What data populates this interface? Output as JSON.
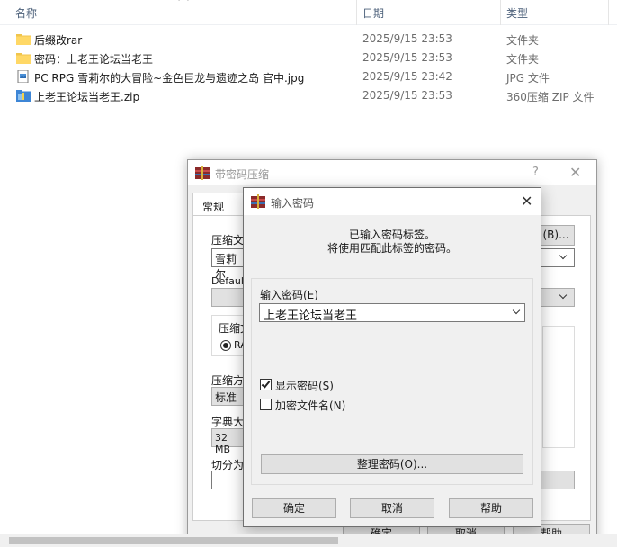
{
  "explorer": {
    "columns": {
      "name": "名称",
      "date": "日期",
      "type": "类型"
    },
    "files": [
      {
        "name": "后缀改rar",
        "date": "2025/9/15 23:53",
        "type": "文件夹",
        "icon": "folder-icon"
      },
      {
        "name": "密码：上老王论坛当老王",
        "date": "2025/9/15 23:53",
        "type": "文件夹",
        "icon": "folder-icon"
      },
      {
        "name": "PC RPG 雪莉尔的大冒险~金色巨龙与遗迹之岛 官中.jpg",
        "date": "2025/9/15 23:42",
        "type": "JPG 文件",
        "icon": "image-file-icon"
      },
      {
        "name": "上老王论坛当老王.zip",
        "date": "2025/9/15 23:53",
        "type": "360压缩 ZIP 文件",
        "icon": "zip-file-icon"
      }
    ]
  },
  "back_dialog": {
    "title": "带密码压缩",
    "help": "?",
    "tab": "常规",
    "archive_label": "压缩文",
    "archive_value": "雪莉尔",
    "browse": "(B)...",
    "default_label": "Default",
    "format_label": "压缩文",
    "format_option": "RA",
    "method_label": "压缩方",
    "method_value": "标准",
    "dict_label": "字典大",
    "dict_value": "32 MB",
    "split_label": "切分为",
    "ok": "确定",
    "cancel": "取消",
    "help_button": "帮助"
  },
  "password_dialog": {
    "title": "输入密码",
    "message_line1": "已输入密码标签。",
    "message_line2": "将使用匹配此标签的密码。",
    "password_label": "输入密码(E)",
    "password_value": "上老王论坛当老王",
    "show_password_label": "显示密码(S)",
    "show_password_checked": true,
    "encrypt_names_label": "加密文件名(N)",
    "encrypt_names_checked": false,
    "organize_button": "整理密码(O)...",
    "ok": "确定",
    "cancel": "取消",
    "help": "帮助"
  }
}
